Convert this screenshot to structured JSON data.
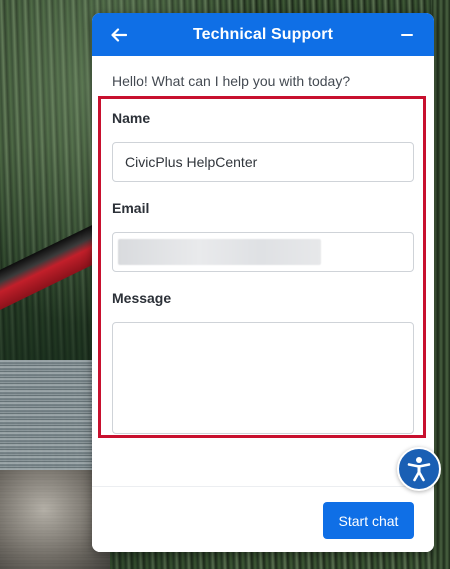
{
  "widget": {
    "title": "Technical Support",
    "back_icon": "arrow-left-icon",
    "minimize_icon": "minus-icon",
    "greeting": "Hello! What can I help you with today?",
    "accent_color": "#0f6fe6",
    "highlight_color": "#c8102e"
  },
  "form": {
    "name_label": "Name",
    "name_value": "CivicPlus HelpCenter",
    "email_label": "Email",
    "email_value": "",
    "message_label": "Message",
    "message_value": ""
  },
  "footer": {
    "start_label": "Start chat"
  },
  "accessibility": {
    "icon": "accessibility-icon"
  }
}
